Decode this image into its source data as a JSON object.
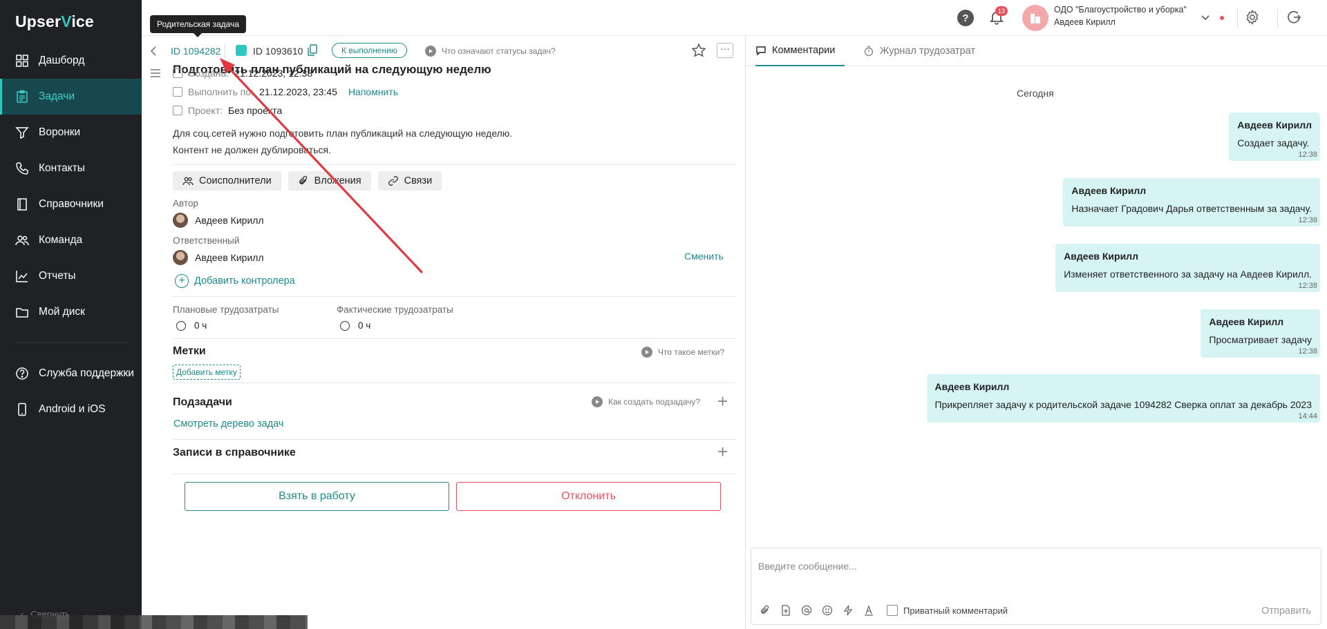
{
  "app": {
    "logo_main": "Upser",
    "logo_accent": "V",
    "logo_tail": "ice"
  },
  "sidebar": {
    "items": [
      {
        "label": "Дашборд",
        "icon": "dashboard-icon"
      },
      {
        "label": "Задачи",
        "icon": "tasks-icon",
        "active": true
      },
      {
        "label": "Воронки",
        "icon": "funnel-icon"
      },
      {
        "label": "Контакты",
        "icon": "phone-icon"
      },
      {
        "label": "Справочники",
        "icon": "book-icon"
      },
      {
        "label": "Команда",
        "icon": "team-icon"
      },
      {
        "label": "Отчеты",
        "icon": "chart-icon"
      },
      {
        "label": "Мой диск",
        "icon": "folder-icon"
      }
    ],
    "support": [
      {
        "label": "Служба поддержки",
        "icon": "help-circle-icon"
      },
      {
        "label": "Android и iOS",
        "icon": "mobile-icon"
      }
    ],
    "collapse_label": "Свернуть"
  },
  "topbar": {
    "help": "?",
    "notifications_count": "13",
    "org_name": "ОДО \"Благоустройство и уборка\"",
    "user_name": "Авдеев Кирилл"
  },
  "tooltip": "Родительская задача",
  "task": {
    "parent_id": "ID 1094282",
    "id": "ID 1093610",
    "status": "К выполнению",
    "status_help": "Что означают статусы задач?",
    "title": "Подготовить план публикаций на следующую неделю",
    "created_label": "Создана:",
    "created_value": "21.12.2023, 12:38",
    "due_label": "Выполнить по:",
    "due_value": "21.12.2023, 23:45",
    "remind": "Напомнить",
    "project_label": "Проект:",
    "project_value": "Без проекта",
    "description_1": "Для соц.сетей нужно подготовить план публикаций на следующую неделю.",
    "description_2": "Контент не должен дублироваться.",
    "chip_coexec": "Соисполнители",
    "chip_attach": "Вложения",
    "chip_links": "Связи",
    "author_label": "Автор",
    "author_name": "Авдеев Кирилл",
    "responsible_label": "Ответственный",
    "responsible_name": "Авдеев Кирилл",
    "change": "Сменить",
    "add_controller": "Добавить контролера",
    "planned_label": "Плановые трудозатраты",
    "planned_value": "0 ч",
    "actual_label": "Фактические трудозатраты",
    "actual_value": "0 ч",
    "labels_title": "Метки",
    "labels_help": "Что такое метки?",
    "add_label": "Добавить метку",
    "subtasks_title": "Подзадачи",
    "subtasks_help": "Как создать подзадачу?",
    "tree_link": "Смотреть дерево задач",
    "records_title": "Записи в справочнике",
    "take_button": "Взять в работу",
    "reject_button": "Отклонить"
  },
  "comments": {
    "tab_comments": "Комментарии",
    "tab_log": "Журнал трудозатрат",
    "today": "Сегодня",
    "messages": [
      {
        "author": "Авдеев Кирилл",
        "text": "Создает задачу.",
        "time": "12:38"
      },
      {
        "author": "Авдеев Кирилл",
        "text": "Назначает Градович Дарья ответственным за задачу.",
        "time": "12:38"
      },
      {
        "author": "Авдеев Кирилл",
        "text": "Изменяет ответственного за задачу на Авдеев Кирилл.",
        "time": "12:38"
      },
      {
        "author": "Авдеев Кирилл",
        "text": "Просматривает задачу",
        "time": "12:38"
      },
      {
        "author": "Авдеев Кирилл",
        "text": "Прикрепляет задачу к родительской задаче 1094282 Сверка оплат за декабрь 2023",
        "time": "14:44"
      }
    ],
    "input_placeholder": "Введите сообщение...",
    "private_label": "Приватный комментарий",
    "send": "Отправить"
  },
  "colors": {
    "accent": "#1d8a8c",
    "sidebar_bg": "#1f2124",
    "bubble": "#d6f4f3",
    "danger": "#e8505b",
    "arrow": "#e0393e"
  }
}
